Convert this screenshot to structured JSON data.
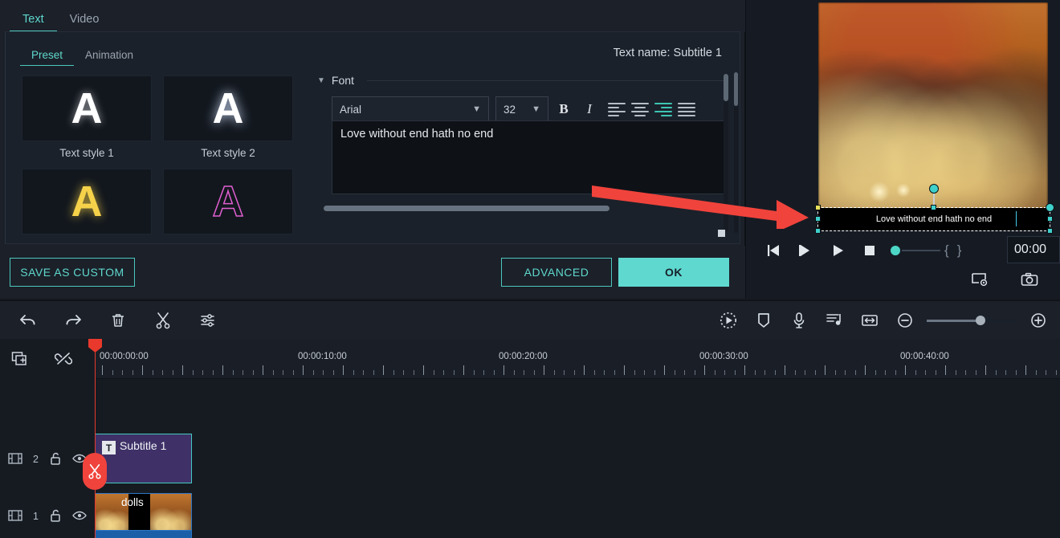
{
  "dialog": {
    "top_tabs": [
      {
        "label": "Text",
        "active": true
      },
      {
        "label": "Video",
        "active": false
      }
    ],
    "sub_tabs": [
      {
        "label": "Preset",
        "active": true
      },
      {
        "label": "Animation",
        "active": false
      }
    ],
    "text_name": "Text name: Subtitle 1",
    "presets": [
      {
        "label": "Text style 1",
        "glyph": "A",
        "style": "g-white"
      },
      {
        "label": "Text style 2",
        "glyph": "A",
        "style": "g-white2"
      },
      {
        "label": "",
        "glyph": "A",
        "style": "g-yellow"
      },
      {
        "label": "",
        "glyph": "A",
        "style": "g-magenta"
      }
    ],
    "font": {
      "section_label": "Font",
      "family": "Arial",
      "size": "32",
      "bold_label": "B",
      "italic_label": "I",
      "alignments": [
        {
          "name": "align-left",
          "active": false
        },
        {
          "name": "align-center",
          "active": false
        },
        {
          "name": "align-right",
          "active": true
        },
        {
          "name": "align-justify",
          "active": false
        }
      ],
      "text_value": "Love without end hath no end"
    },
    "buttons": {
      "save_as_custom": "SAVE AS CUSTOM",
      "advanced": "ADVANCED",
      "ok": "OK"
    }
  },
  "preview": {
    "overlay_text": "Love without end hath no end",
    "timecode": "00:00",
    "controls": [
      {
        "name": "prev-frame-button"
      },
      {
        "name": "next-frame-button"
      },
      {
        "name": "play-button"
      },
      {
        "name": "stop-button"
      }
    ],
    "mark_in": "{",
    "mark_out": "}",
    "foot_icons": [
      {
        "name": "display-settings-icon"
      },
      {
        "name": "snapshot-camera-icon"
      }
    ]
  },
  "toolbar": {
    "left_icons": [
      {
        "name": "undo-button"
      },
      {
        "name": "redo-button"
      },
      {
        "name": "delete-button"
      },
      {
        "name": "split-button"
      },
      {
        "name": "settings-button"
      }
    ],
    "right_icons": [
      {
        "name": "record-voiceover-button"
      },
      {
        "name": "marker-button"
      },
      {
        "name": "microphone-button"
      },
      {
        "name": "audio-detach-button"
      },
      {
        "name": "fit-timeline-button"
      },
      {
        "name": "zoom-out-button"
      },
      {
        "name": "zoom-in-button"
      }
    ]
  },
  "timeline": {
    "header_icons": [
      {
        "name": "add-track-icon"
      },
      {
        "name": "unlink-icon"
      }
    ],
    "ruler_labels": [
      "00:00:00:00",
      "00:00:10:00",
      "00:00:20:00",
      "00:00:30:00",
      "00:00:40:00"
    ],
    "tracks": [
      {
        "number": "2",
        "type": "text",
        "clip_name": "Subtitle 1",
        "clip_badge": "T"
      },
      {
        "number": "1",
        "type": "video",
        "clip_name": "dolls"
      }
    ]
  },
  "colors": {
    "accent_teal": "#5fd8cd",
    "ok_button": "#5fd9d0",
    "playhead_red": "#e8392c",
    "annotation_arrow": "#f0433c",
    "text_clip": "#3f3168",
    "video_clip_border": "#2e76c4"
  }
}
